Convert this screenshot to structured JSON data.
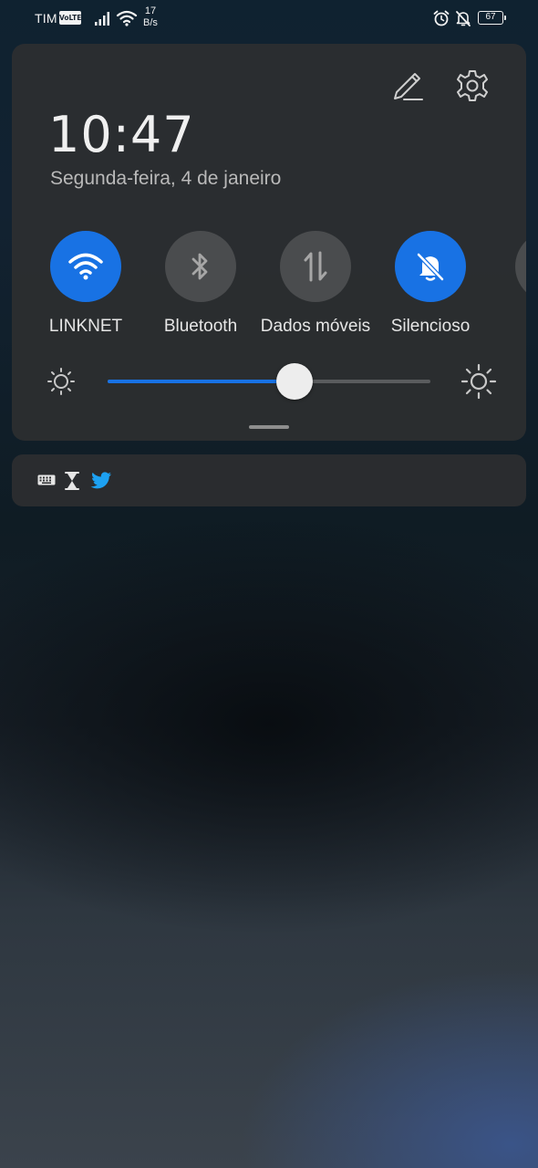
{
  "status_bar": {
    "carrier": "TIM",
    "volte": "VoLTE",
    "net_speed_value": "17",
    "net_speed_unit": "B/s",
    "battery": "67",
    "icons": [
      "signal-icon",
      "wifi-icon",
      "alarm-icon",
      "silent-bell-icon",
      "battery-icon"
    ]
  },
  "panel": {
    "time": "10:47",
    "date": "Segunda-feira, 4 de janeiro",
    "header_icons": [
      "edit-icon",
      "settings-icon"
    ],
    "tiles": [
      {
        "label": "LINKNET",
        "icon": "wifi-icon",
        "active": true
      },
      {
        "label": "Bluetooth",
        "icon": "bluetooth-icon",
        "active": false
      },
      {
        "label": "Dados móveis",
        "icon": "mobile-data-icon",
        "active": false
      },
      {
        "label": "Silencioso",
        "icon": "silent-bell-icon",
        "active": true
      }
    ],
    "brightness": {
      "level": 0.58,
      "low_icon": "brightness-low-icon",
      "high_icon": "brightness-high-icon"
    }
  },
  "notification_strip": {
    "icons": [
      "keyboard-icon",
      "hourglass-icon",
      "twitter-icon"
    ]
  },
  "colors": {
    "accent": "#1872e4",
    "panel": "#2c2e30",
    "inactive_tile": "#4a4c4e",
    "twitter": "#1da1f2"
  }
}
